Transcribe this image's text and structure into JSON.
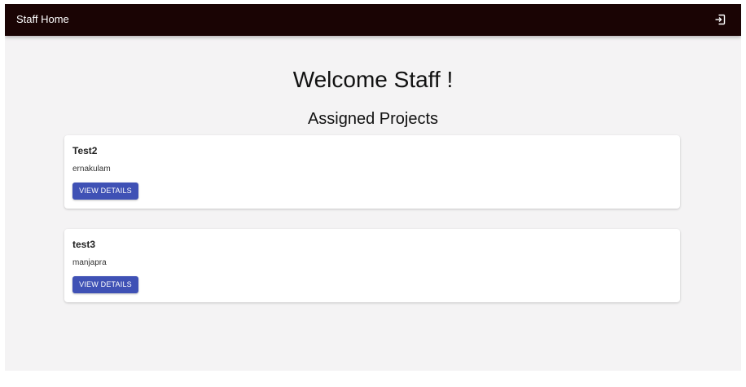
{
  "appbar": {
    "title": "Staff Home",
    "logout_icon": "logout-icon"
  },
  "main": {
    "welcome": "Welcome Staff !",
    "section_title": "Assigned Projects"
  },
  "projects": [
    {
      "name": "Test2",
      "location": "ernakulam",
      "button_label": "VIEW DETAILS"
    },
    {
      "name": "test3",
      "location": "manjapra",
      "button_label": "VIEW DETAILS"
    }
  ],
  "colors": {
    "appbar_bg": "#1a0404",
    "page_bg": "#f4f3f4",
    "button_bg": "#3f51b5"
  }
}
